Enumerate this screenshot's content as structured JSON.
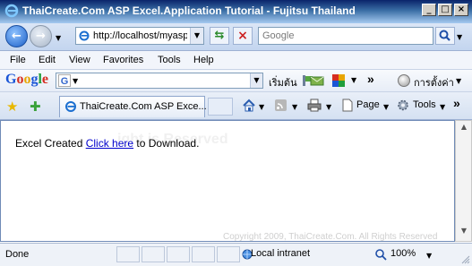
{
  "window": {
    "title": "ThaiCreate.Com ASP Excel.Application Tutorial - Fujitsu Thailand",
    "controls": [
      "minimize",
      "maximize",
      "close"
    ]
  },
  "navbar": {
    "address": "http://localhost/myasp",
    "search_placeholder": "Google"
  },
  "menu": {
    "items": [
      "File",
      "Edit",
      "View",
      "Favorites",
      "Tools",
      "Help"
    ]
  },
  "google_toolbar": {
    "logo": "Google",
    "search_letter": "G",
    "start_label": "เริ่มต้น",
    "more": "»",
    "settings_label": "การตั้งค่า"
  },
  "command_bar": {
    "tab_title": "ThaiCreate.Com ASP Exce...",
    "more": "»",
    "page_label": "Page",
    "tools_label": "Tools"
  },
  "content": {
    "prefix": "Excel Created ",
    "link": "Click here",
    "suffix": " to Download.",
    "watermark": "ight is Reserved",
    "footer_watermark": "Copyright 2009, ThaiCreate.Com. All Rights Reserved"
  },
  "statusbar": {
    "status": "Done",
    "zone": "Local intranet",
    "zoom": "100%"
  }
}
